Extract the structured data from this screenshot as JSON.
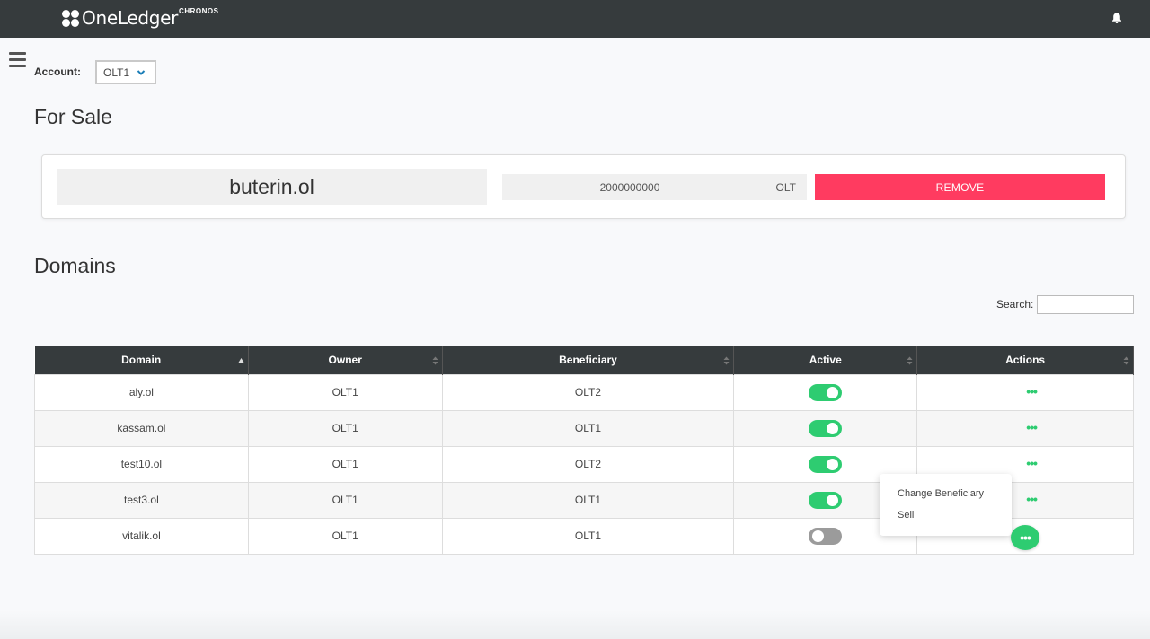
{
  "header": {
    "logo_text": "OneLedger",
    "logo_sup": "CHRONOS",
    "bell_icon": "bell-icon"
  },
  "account": {
    "label": "Account:",
    "value": "OLT1"
  },
  "for_sale": {
    "title": "For Sale",
    "domain": "buterin.ol",
    "price": "2000000000",
    "currency": "OLT",
    "remove_label": "REMOVE"
  },
  "domains": {
    "title": "Domains",
    "search_label": "Search:",
    "search_value": "",
    "columns": [
      "Domain",
      "Owner",
      "Beneficiary",
      "Active",
      "Actions"
    ],
    "rows": [
      {
        "domain": "aly.ol",
        "owner": "OLT1",
        "beneficiary": "OLT2",
        "active": true
      },
      {
        "domain": "kassam.ol",
        "owner": "OLT1",
        "beneficiary": "OLT1",
        "active": true
      },
      {
        "domain": "test10.ol",
        "owner": "OLT1",
        "beneficiary": "OLT2",
        "active": true
      },
      {
        "domain": "test3.ol",
        "owner": "OLT1",
        "beneficiary": "OLT1",
        "active": true
      },
      {
        "domain": "vitalik.ol",
        "owner": "OLT1",
        "beneficiary": "OLT1",
        "active": false
      }
    ],
    "actions_glyph": "•••"
  },
  "action_menu": {
    "items": [
      "Change Beneficiary",
      "Sell"
    ]
  },
  "colors": {
    "topbar": "#363b3d",
    "accent_green": "#2ecc71",
    "remove_red": "#ff3b60"
  }
}
